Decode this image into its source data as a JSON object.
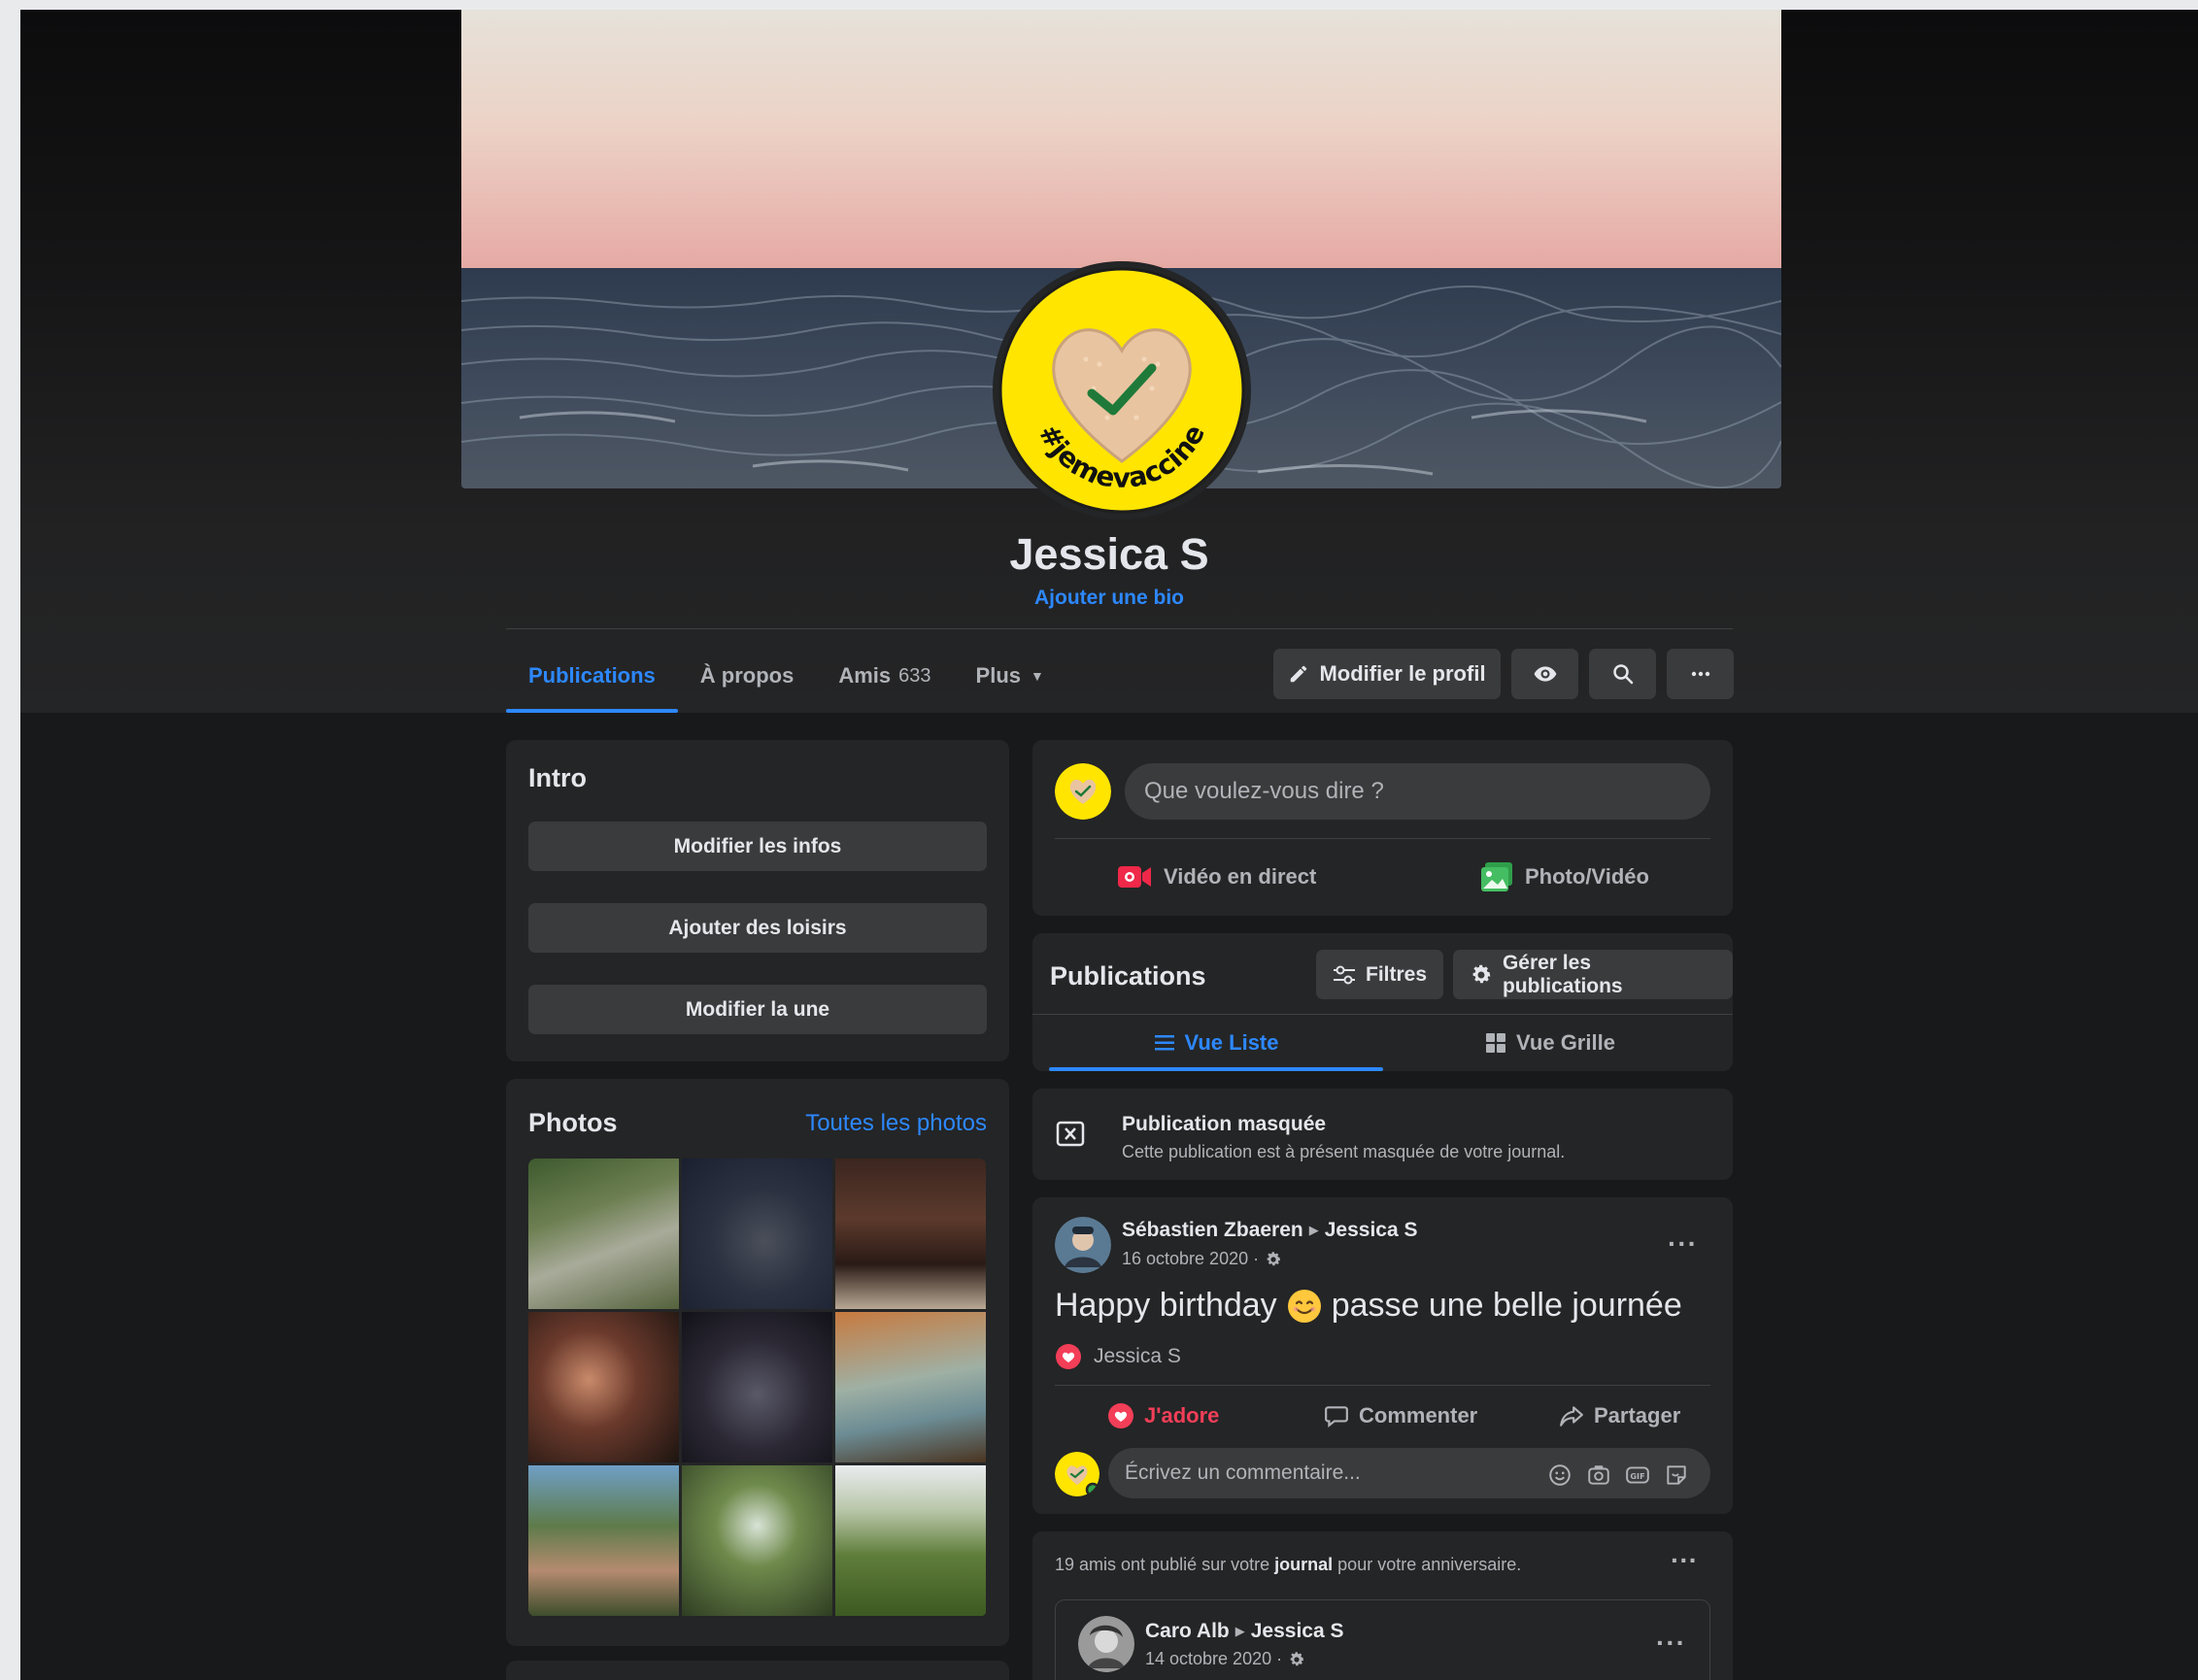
{
  "profile": {
    "name": "Jessica S",
    "bio_link": "Ajouter une bio",
    "avatar_hashtag": "#jemevaccine"
  },
  "tabs": [
    {
      "label": "Publications",
      "active": true
    },
    {
      "label": "À propos"
    },
    {
      "label": "Amis",
      "count": "633"
    },
    {
      "label": "Plus"
    }
  ],
  "actions": {
    "edit_profile": "Modifier le profil"
  },
  "intro": {
    "title": "Intro",
    "buttons": [
      "Modifier les infos",
      "Ajouter des loisirs",
      "Modifier la une"
    ]
  },
  "photos": {
    "title": "Photos",
    "all_link": "Toutes les photos"
  },
  "composer": {
    "placeholder": "Que voulez-vous dire ?",
    "live_video": "Vidéo en direct",
    "photo_video": "Photo/Vidéo"
  },
  "publications": {
    "title": "Publications",
    "filters": "Filtres",
    "manage": "Gérer les publications",
    "list_view": "Vue Liste",
    "grid_view": "Vue Grille"
  },
  "hidden_post": {
    "title": "Publication masquée",
    "text": "Cette publication est à présent masquée de votre journal."
  },
  "post": {
    "author": "Sébastien Zbaeren",
    "target": "Jessica S",
    "date": "16 octobre 2020 ·",
    "text_before": "Happy birthday",
    "text_after": "passe une belle journée",
    "reactor": "Jessica S",
    "love": "J'adore",
    "comment": "Commenter",
    "share": "Partager",
    "comment_placeholder": "Écrivez un commentaire..."
  },
  "birthday": {
    "text_before": "19 amis ont publié sur votre",
    "text_bold": "journal",
    "text_after": "pour votre anniversaire.",
    "inner_author": "Caro Alb",
    "inner_target": "Jessica S",
    "inner_date": "14 octobre 2020 ·"
  },
  "colors": {
    "accent": "#2d88ff",
    "love": "#f33e58",
    "page_bg": "#18191a",
    "card_bg": "#242526"
  }
}
